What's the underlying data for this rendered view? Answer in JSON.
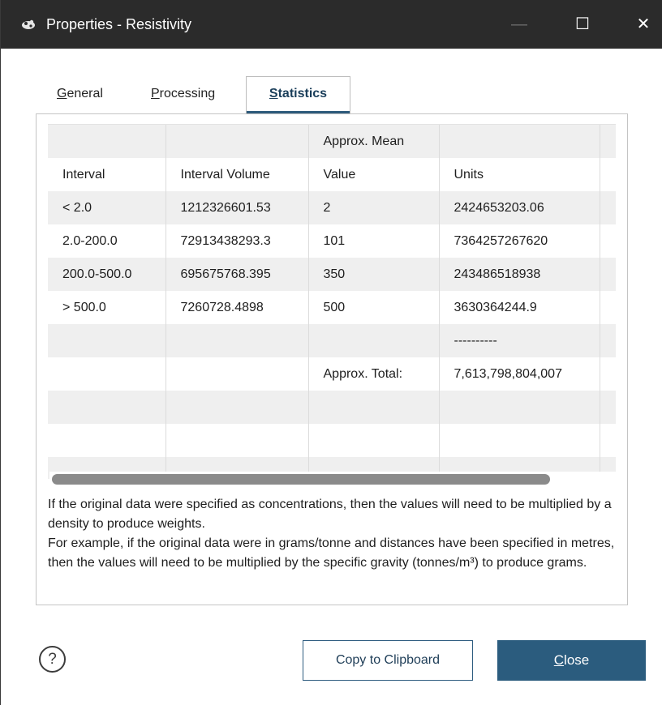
{
  "window": {
    "title": "Properties - Resistivity",
    "minimize_glyph": "—",
    "maximize_glyph": "☐",
    "close_glyph": "✕"
  },
  "tabs": [
    {
      "label_ul": "G",
      "label_rest": "eneral"
    },
    {
      "label_ul": "P",
      "label_rest": "rocessing"
    },
    {
      "label_ul": "S",
      "label_rest": "tatistics"
    }
  ],
  "table": {
    "header_row1": [
      "",
      "",
      "Approx. Mean",
      ""
    ],
    "header_row2": [
      "Interval",
      "Interval Volume",
      "Value",
      "Units"
    ],
    "rows": [
      [
        "< 2.0",
        "1212326601.53",
        "2",
        "2424653203.06"
      ],
      [
        "2.0-200.0",
        "72913438293.3",
        "101",
        "7364257267620"
      ],
      [
        "200.0-500.0",
        "695675768.395",
        "350",
        "243486518938"
      ],
      [
        "> 500.0",
        "7260728.4898",
        "500",
        "3630364244.9"
      ],
      [
        "",
        "",
        "",
        "----------"
      ],
      [
        "",
        "",
        "Approx. Total:",
        "7,613,798,804,007"
      ],
      [
        "",
        "",
        "",
        ""
      ],
      [
        "",
        "",
        "",
        ""
      ],
      [
        "",
        "",
        "",
        ""
      ]
    ]
  },
  "note": {
    "line1": "If the original data were specified as concentrations, then the values will need to be multiplied by a density to produce weights.",
    "line2": "For example, if the original data were in grams/tonne and distances have been specified in metres, then the values will need to be multiplied by the specific gravity (tonnes/m³) to produce grams."
  },
  "footer": {
    "help_glyph": "?",
    "copy_label": "Copy to Clipboard",
    "close_ul": "C",
    "close_rest": "lose"
  },
  "colors": {
    "titlebar": "#2b2b2b",
    "accent": "#2b5c7e",
    "row_shade": "#efefef"
  }
}
